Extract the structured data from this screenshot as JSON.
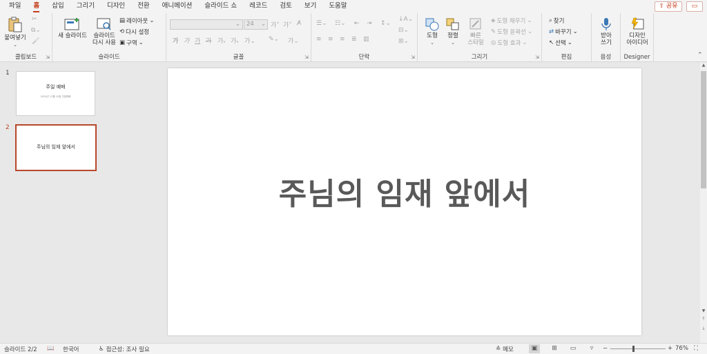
{
  "tabs": [
    "파일",
    "홈",
    "삽입",
    "그리기",
    "디자인",
    "전환",
    "애니메이션",
    "슬라이드 쇼",
    "레코드",
    "검토",
    "보기",
    "도움말"
  ],
  "active_tab": "홈",
  "share_label": "공유",
  "groups": {
    "clipboard": {
      "label": "클립보드",
      "paste": "붙여넣기"
    },
    "slides": {
      "label": "슬라이드",
      "new_slide": "새 슬라이드",
      "reuse_slide_1": "슬라이드",
      "reuse_slide_2": "다시 사용",
      "layout": "레이아웃",
      "reset": "다시 설정",
      "section": "구역"
    },
    "font": {
      "label": "글꼴",
      "size": "24",
      "bold": "가",
      "italic": "가",
      "underline": "가",
      "strike": "가",
      "font_color_char": "가"
    },
    "paragraph": {
      "label": "단락"
    },
    "drawing": {
      "label": "그리기",
      "shapes": "도형",
      "arrange": "정렬",
      "quick_styles_1": "빠른",
      "quick_styles_2": "스타일",
      "shape_fill": "도형 채우기",
      "shape_outline": "도형 윤곽선",
      "shape_effects": "도형 효과"
    },
    "editing": {
      "label": "편집",
      "find": "찾기",
      "replace": "바꾸기",
      "select": "선택"
    },
    "voice": {
      "label": "음성",
      "dictate_1": "받아",
      "dictate_2": "쓰기"
    },
    "designer": {
      "label": "Designer",
      "ideas_1": "디자인",
      "ideas_2": "아이디어"
    }
  },
  "slides": [
    {
      "number": "1",
      "title": "주일 예배",
      "subtitle": "2024년 11월 10일 주일예배"
    },
    {
      "number": "2",
      "title": "주님의 임재 앞에서"
    }
  ],
  "current_slide_title": "주님의 임재 앞에서",
  "status": {
    "slide_info": "슬라이드 2/2",
    "language": "한국어",
    "accessibility": "접근성: 조사 필요",
    "notes": "메모",
    "zoom": "76%"
  }
}
